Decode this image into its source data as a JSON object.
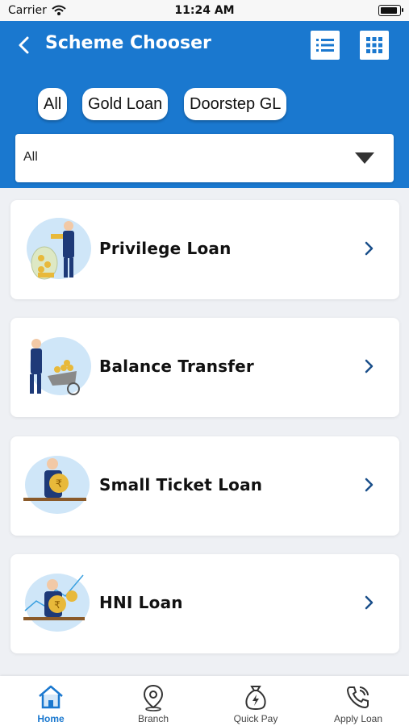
{
  "status_bar": {
    "carrier": "Carrier",
    "time": "11:24 AM"
  },
  "header": {
    "title": "Scheme Chooser"
  },
  "filters": {
    "chips": [
      "All",
      "Gold Loan",
      "Doorstep GL"
    ],
    "dropdown_value": "All"
  },
  "schemes": [
    {
      "label": "Privilege Loan"
    },
    {
      "label": "Balance Transfer"
    },
    {
      "label": "Small Ticket Loan"
    },
    {
      "label": "HNI Loan"
    }
  ],
  "bottom_nav": {
    "items": [
      {
        "label": "Home",
        "icon": "home-icon",
        "active": true
      },
      {
        "label": "Branch",
        "icon": "location-pin-icon",
        "active": false
      },
      {
        "label": "Quick Pay",
        "icon": "money-bag-icon",
        "active": false
      },
      {
        "label": "Apply Loan",
        "icon": "phone-icon",
        "active": false
      }
    ]
  },
  "colors": {
    "primary": "#1a78cf",
    "background": "#eef0f4",
    "chevron": "#1a4f8a"
  }
}
